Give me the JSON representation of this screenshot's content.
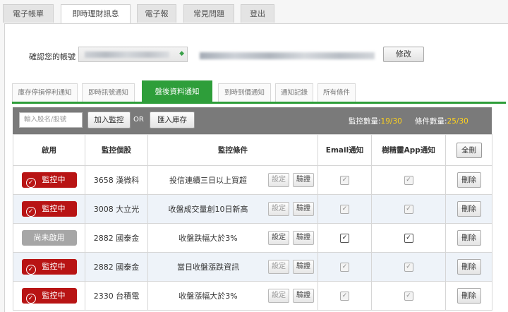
{
  "top_tabs": [
    "電子帳單",
    "即時理財訊息",
    "電子報",
    "常見問題",
    "登出"
  ],
  "account": {
    "label": "確認您的帳號",
    "edit_label": "修改"
  },
  "sub_tabs": [
    "庫存停損停利通知",
    "即時訊號通知",
    "盤後資料通知",
    "到時到價通知",
    "通知記錄",
    "所有條件"
  ],
  "toolbar": {
    "input_placeholder": "輸入股名/股號",
    "add_label": "加入監控",
    "or_label": "OR",
    "import_label": "匯入庫存",
    "monitor_count_label": "監控數量:",
    "monitor_count": "19/30",
    "condition_count_label": "條件數量:",
    "condition_count": "25/30"
  },
  "table": {
    "headers": [
      "啟用",
      "監控個股",
      "監控條件",
      "Email通知",
      "樹精靈App通知"
    ],
    "delete_all_label": "全刪",
    "settings_label": "設定",
    "verify_label": "驗證",
    "delete_label": "刪除",
    "rows": [
      {
        "status": "監控中",
        "active": true,
        "stock": "3658 漢微科",
        "condition": "投信連續三日以上買超",
        "email": false,
        "app": false
      },
      {
        "status": "監控中",
        "active": true,
        "stock": "3008 大立光",
        "condition": "收盤成交量創10日新高",
        "email": false,
        "app": false
      },
      {
        "status": "尚未啟用",
        "active": false,
        "stock": "2882 國泰金",
        "condition": "收盤跌幅大於3%",
        "email": true,
        "app": true
      },
      {
        "status": "監控中",
        "active": true,
        "stock": "2882 國泰金",
        "condition": "當日收盤漲跌資訊",
        "email": false,
        "app": false
      },
      {
        "status": "監控中",
        "active": true,
        "stock": "2330 台積電",
        "condition": "收盤漲幅大於3%",
        "email": false,
        "app": false
      }
    ]
  },
  "colors": {
    "accent_green": "#2e9e3a",
    "active_red": "#b81414",
    "inactive_gray": "#a6a6a6",
    "toolbar_gray": "#7a7a7a",
    "count_yellow": "#ffd21e"
  }
}
